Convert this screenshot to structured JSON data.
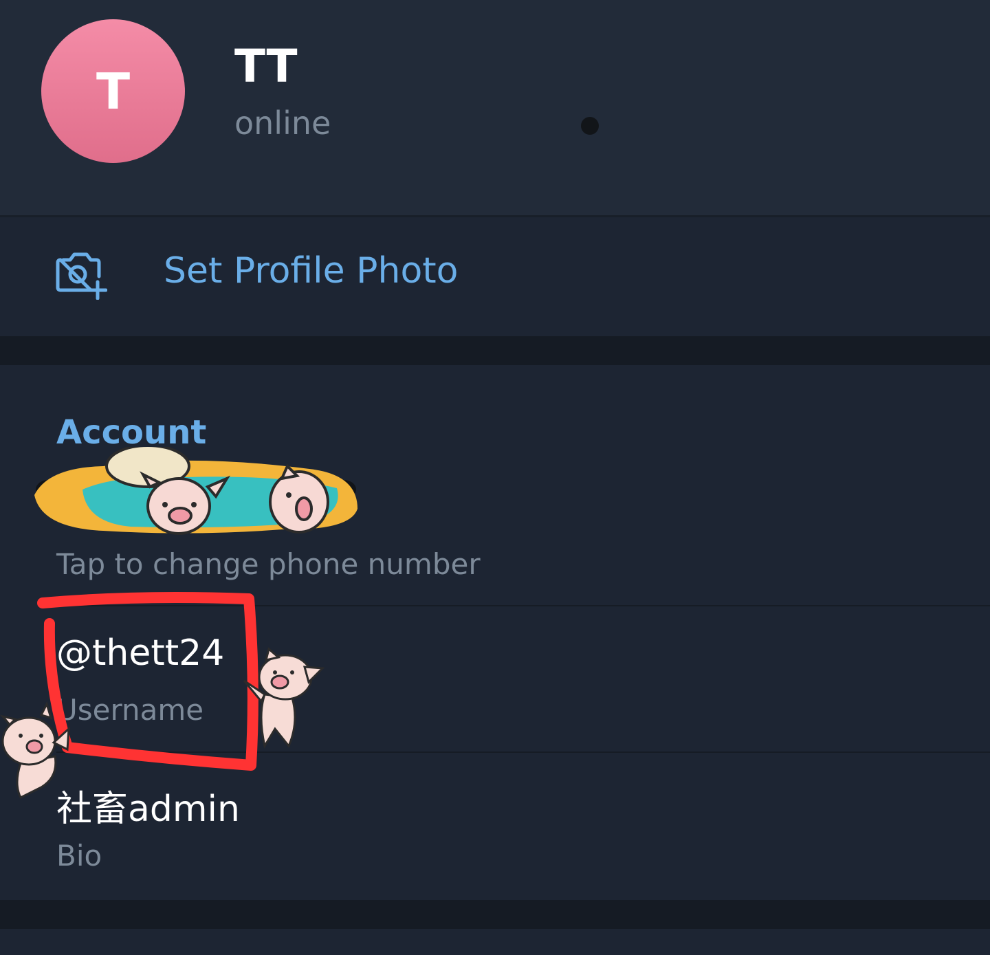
{
  "profile": {
    "avatar_letter": "T",
    "name": "TT",
    "status": "online"
  },
  "actions": {
    "set_photo_label": "Set Profile Photo"
  },
  "account": {
    "title": "Account",
    "phone_hint": "Tap to change phone number",
    "username_value": "@thett24",
    "username_label": "Username",
    "bio_value": "社畜admin",
    "bio_label": "Bio"
  },
  "colors": {
    "accent": "#6aaee8",
    "avatar": "#f07c9a",
    "background": "#1d2533",
    "header": "#222b39",
    "muted_text": "#7d8a99",
    "annotation": "#ff3333"
  },
  "icons": {
    "camera": "camera-add-icon"
  }
}
